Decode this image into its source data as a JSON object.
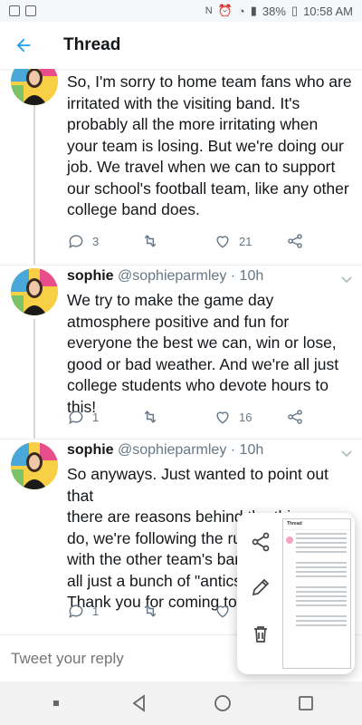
{
  "status_bar": {
    "battery": "38%",
    "time": "10:58 AM"
  },
  "header": {
    "title": "Thread"
  },
  "tweets": [
    {
      "text": "So, I'm sorry to home team fans who are irritated with the visiting band. It's probably all the more irritating when your team is losing. But we're doing our job. We travel when we can to support our school's football team, like any other college band does.",
      "replies": "3",
      "retweets": "",
      "likes": "21"
    },
    {
      "name": "sophie",
      "handle": "@sophieparmley",
      "time": "10h",
      "text": "We try to make the game day atmosphere positive and fun for everyone the best we can, win or lose, good or bad weather. And we're all just college students who devote hours to this!",
      "replies": "1",
      "retweets": "",
      "likes": "16"
    },
    {
      "name": "sophie",
      "handle": "@sophieparmley",
      "time": "10h",
      "text_lines": [
        "So anyways. Just wanted to point out that",
        "there are reasons behind the things we",
        "do, we're following the rules and working",
        "with the other team's ban",
        "all just a bunch of \"antics",
        "Thank you for coming to"
      ],
      "replies": "1",
      "retweets": "",
      "likes": ""
    }
  ],
  "reply": {
    "placeholder": "Tweet your reply"
  },
  "screenshot_preview": {
    "title": "Thread"
  },
  "icons": {
    "back": "arrow-left-icon",
    "reply": "speech-bubble-icon",
    "retweet": "retweet-icon",
    "like": "heart-icon",
    "share": "share-icon",
    "edit": "pencil-icon",
    "delete": "trash-icon"
  },
  "colors": {
    "accent": "#1da1f2",
    "muted": "#657786",
    "divider": "#e6ecf0"
  }
}
